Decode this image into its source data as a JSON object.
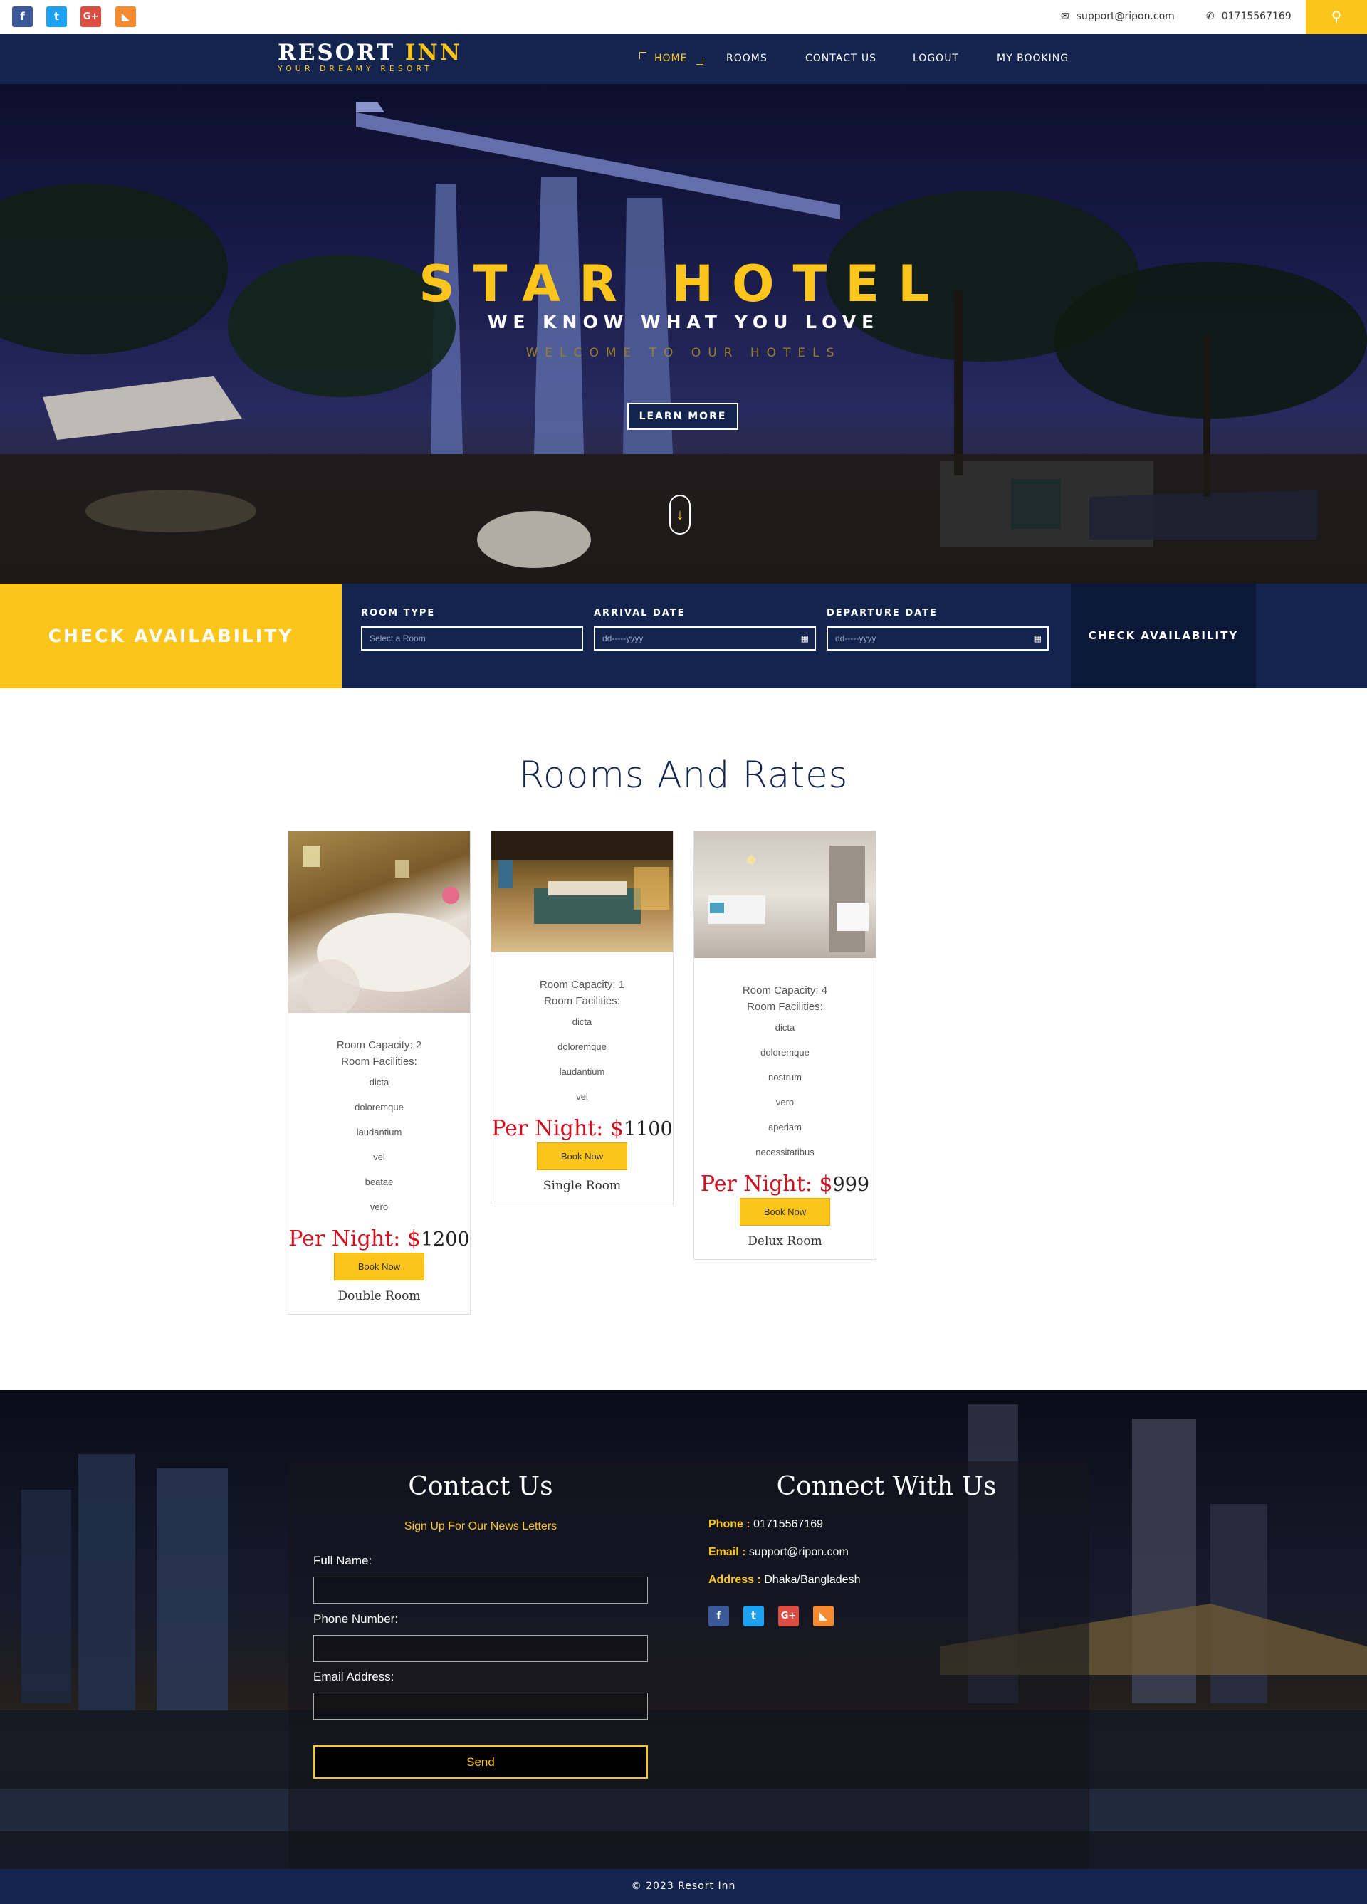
{
  "colors": {
    "accent": "#fcc51c",
    "navy": "#13244e",
    "price_red": "#d30f1d"
  },
  "topbar": {
    "social": [
      {
        "name": "facebook-icon",
        "glyph": "f"
      },
      {
        "name": "twitter-icon",
        "glyph": "t"
      },
      {
        "name": "google-plus-icon",
        "glyph": "G+"
      },
      {
        "name": "rss-icon",
        "glyph": "◣"
      }
    ],
    "email": "support@ripon.com",
    "phone": "01715567169",
    "search_icon": "search-icon"
  },
  "brand": {
    "name_white": "RESORT",
    "name_yellow": "INN",
    "tagline": "YOUR DREAMY RESORT"
  },
  "nav": {
    "home": "HOME",
    "rooms": "ROOMS",
    "contact": "CONTACT US",
    "logout": "LOGOUT",
    "booking": "MY BOOKING"
  },
  "hero": {
    "title": "STAR HOTEL",
    "subtitle": "WE KNOW WHAT YOU LOVE",
    "welcome": "WELCOME TO OUR HOTELS",
    "button": "LEARN MORE"
  },
  "availability": {
    "heading": "CHECK AVAILABILITY",
    "room_type_label": "ROOM TYPE",
    "room_type_placeholder": "Select a Room",
    "arrival_label": "ARRIVAL DATE",
    "arrival_placeholder": "dd-----yyyy",
    "departure_label": "DEPARTURE DATE",
    "departure_placeholder": "dd-----yyyy",
    "button": "CHECK AVAILABILITY"
  },
  "rooms": {
    "title": "Rooms And Rates",
    "per_night": "Per Night: $",
    "book_label": "Book Now",
    "facilities_label": "Room Facilities:",
    "capacity_prefix": "Room Capacity: ",
    "cards": [
      {
        "capacity": "2",
        "facilities": [
          "dicta",
          "doloremque",
          "laudantium",
          "vel",
          "beatae",
          "vero"
        ],
        "price": "1200",
        "name": "Double Room"
      },
      {
        "capacity": "1",
        "facilities": [
          "dicta",
          "doloremque",
          "laudantium",
          "vel"
        ],
        "price": "1100",
        "name": "Single Room"
      },
      {
        "capacity": "4",
        "facilities": [
          "dicta",
          "doloremque",
          "nostrum",
          "vero",
          "aperiam",
          "necessitatibus"
        ],
        "price": "999",
        "name": "Delux Room"
      }
    ]
  },
  "footer": {
    "contact_title": "Contact Us",
    "newsletter": "Sign Up For Our News Letters",
    "full_name": "Full Name:",
    "phone_number": "Phone Number:",
    "email_address": "Email Address:",
    "send": "Send",
    "connect_title": "Connect With Us",
    "phone_label": "Phone :",
    "phone": "01715567169",
    "email_label": "Email :",
    "email": "support@ripon.com",
    "address_label": "Address :",
    "address": "Dhaka/Bangladesh"
  },
  "copyright": "© 2023 Resort Inn"
}
